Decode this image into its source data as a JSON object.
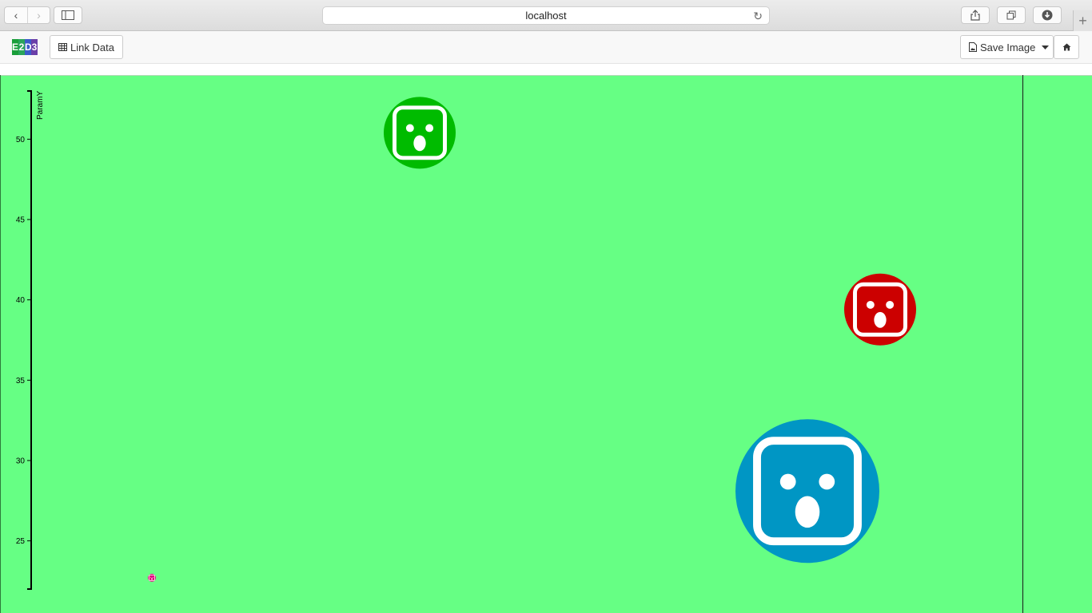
{
  "browser": {
    "url": "localhost",
    "back_icon": "chevron-left-icon",
    "forward_icon": "chevron-right-icon",
    "sidebar_icon": "sidebar-icon",
    "share_icon": "share-icon",
    "tabs_icon": "tabs-icon",
    "download_icon": "download-icon",
    "reload_icon": "reload-icon",
    "new_tab_label": "+"
  },
  "toolbar": {
    "logo_letters": [
      "E",
      "2",
      "D",
      "3"
    ],
    "logo_colors": [
      "#1a9e3a",
      "#2aa55a",
      "#3b5bc9",
      "#6a3fa8"
    ],
    "link_data_label": "Link Data",
    "save_image_label": "Save Image",
    "home_icon": "home-icon"
  },
  "colors": {
    "plot_background": "#66ff84",
    "green_face": "#00bb00",
    "red_face": "#cc0000",
    "blue_face": "#0096c4",
    "pink_face": "#e0007a"
  },
  "chart_data": {
    "type": "scatter",
    "ylabel": "ParamY",
    "ylim": [
      22,
      53
    ],
    "y_ticks": [
      "25",
      "30",
      "35",
      "40",
      "45",
      "50"
    ],
    "glyph": "surprised-face",
    "points": [
      {
        "y": 50.4,
        "color": "#00bb00",
        "size": "medium"
      },
      {
        "y": 39.4,
        "color": "#cc0000",
        "size": "medium"
      },
      {
        "y": 28.1,
        "color": "#0096c4",
        "size": "large"
      },
      {
        "y": 22.7,
        "color": "#e0007a",
        "size": "tiny"
      }
    ]
  }
}
